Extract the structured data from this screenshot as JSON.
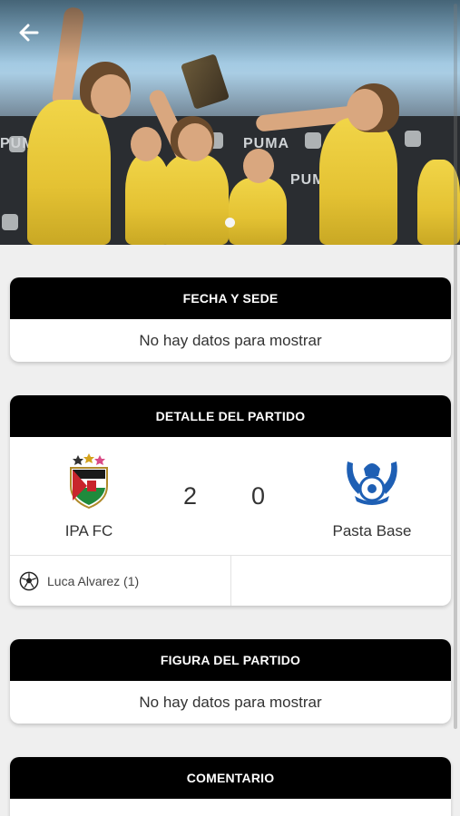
{
  "sections": {
    "venue": {
      "title": "FECHA Y SEDE",
      "empty": "No hay datos para mostrar"
    },
    "match": {
      "title": "DETALLE DEL PARTIDO",
      "home": {
        "name": "IPA FC",
        "score": "2"
      },
      "away": {
        "name": "Pasta Base",
        "score": "0"
      },
      "home_scorers": [
        "Luca Alvarez (1)"
      ],
      "away_scorers": []
    },
    "mvp": {
      "title": "FIGURA DEL PARTIDO",
      "empty": "No hay datos para mostrar"
    },
    "comment": {
      "title": "COMENTARIO"
    }
  },
  "hero": {
    "banner_text": "PUMA",
    "jersey_color": "#e8c63a"
  },
  "icons": {
    "back": "arrow-left-icon",
    "goal": "soccer-ball-icon"
  },
  "colors": {
    "header_bg": "#000000",
    "page_bg": "#efefef"
  }
}
